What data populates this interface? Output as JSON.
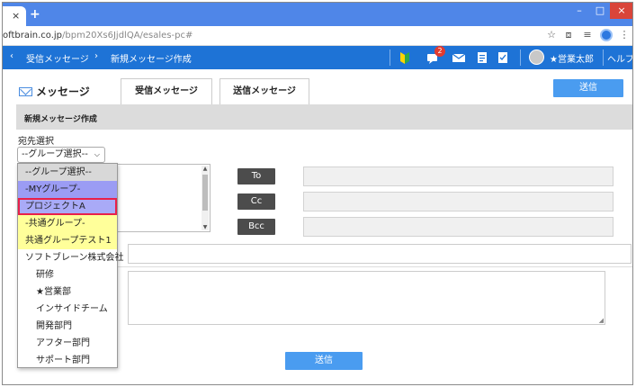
{
  "browser": {
    "tab_close": "×",
    "new_tab": "+",
    "window_min": "–",
    "window_max": "□",
    "window_close": "×",
    "url_host": "oftbrain.co.jp",
    "url_path": "/bpm20Xs6JjdlQA/esales-pc#",
    "address_icons": [
      "star-icon",
      "cast-icon",
      "reading-list-icon",
      "menu-icon"
    ]
  },
  "header": {
    "back_arrow": "‹",
    "crumb_1": "受信メッセージ",
    "separator": "›",
    "crumb_2": "新規メッセージ作成",
    "notification_count": "2",
    "user_name": "★営業太郎",
    "help": "ヘルプ",
    "icons": [
      "beginner-mark-icon",
      "notification-icon",
      "mail-icon",
      "notes-icon",
      "checklist-icon"
    ]
  },
  "page": {
    "title": "メッセージ",
    "tab_inbox": "受信メッセージ",
    "tab_sent": "送信メッセージ",
    "send_button": "送信",
    "section_title": "新規メッセージ作成",
    "destination_label": "宛先選択",
    "group_select_value": "--グループ選択--",
    "to_button": "To",
    "cc_button": "Cc",
    "bcc_button": "Bcc",
    "send_button_bottom": "送信"
  },
  "dropdown": {
    "options": [
      {
        "label": "--グループ選択--",
        "kind": "head"
      },
      {
        "label": "-MYグループ-",
        "kind": "my"
      },
      {
        "label": "プロジェクトA",
        "kind": "proj"
      },
      {
        "label": "-共通グループ-",
        "kind": "common"
      },
      {
        "label": "共通グループテスト1",
        "kind": "common"
      },
      {
        "label": "ソフトブレーン株式会社",
        "kind": "plain"
      },
      {
        "label": "研修",
        "kind": "indent"
      },
      {
        "label": "★営業部",
        "kind": "indent"
      },
      {
        "label": "インサイドチーム",
        "kind": "indent"
      },
      {
        "label": "開発部門",
        "kind": "indent"
      },
      {
        "label": "アフター部門",
        "kind": "indent"
      },
      {
        "label": "サポート部門",
        "kind": "indent"
      }
    ]
  },
  "colors": {
    "tabbar": "#4f86e8",
    "app_header": "#1e73d6",
    "send_button": "#4a9cf0",
    "recipient_button": "#4c4c4c",
    "highlight_outline": "#e8204a"
  }
}
